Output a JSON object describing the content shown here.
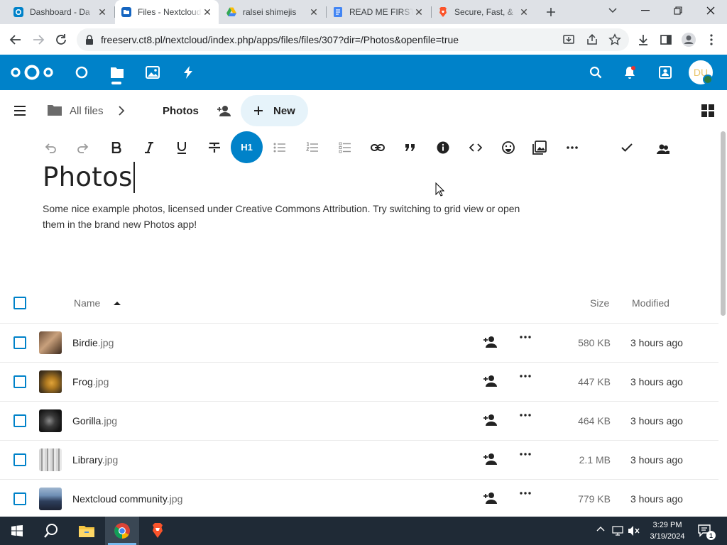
{
  "browser": {
    "tabs": [
      {
        "title": "Dashboard - Da",
        "favicon": "nextcloud-icon"
      },
      {
        "title": "Files - Nextcloud",
        "favicon": "files-icon",
        "active": true
      },
      {
        "title": "ralsei shimejis",
        "favicon": "drive-icon"
      },
      {
        "title": "READ ME FIRST",
        "favicon": "docs-icon"
      },
      {
        "title": "Secure, Fast, &",
        "favicon": "brave-icon"
      }
    ],
    "url": "freeserv.ct8.pl/nextcloud/index.php/apps/files/files/307?dir=/Photos&openfile=true"
  },
  "header": {
    "avatar_initials": "DU",
    "accent": "#0082c9"
  },
  "breadcrumb": {
    "root": "All files",
    "current": "Photos",
    "new_label": "New"
  },
  "editor": {
    "heading_button": "H1",
    "title": "Photos",
    "description": "Some nice example photos, licensed under Creative Commons Attribution. Try switching to grid view or open them in the brand new Photos app!"
  },
  "table": {
    "col_name": "Name",
    "col_size": "Size",
    "col_modified": "Modified",
    "rows": [
      {
        "base": "Birdie",
        "ext": ".jpg",
        "size": "580 KB",
        "modified": "3 hours ago"
      },
      {
        "base": "Frog",
        "ext": ".jpg",
        "size": "447 KB",
        "modified": "3 hours ago"
      },
      {
        "base": "Gorilla",
        "ext": ".jpg",
        "size": "464 KB",
        "modified": "3 hours ago"
      },
      {
        "base": "Library",
        "ext": ".jpg",
        "size": "2.1 MB",
        "modified": "3 hours ago"
      },
      {
        "base": "Nextcloud community",
        "ext": ".jpg",
        "size": "779 KB",
        "modified": "3 hours ago"
      }
    ]
  },
  "taskbar": {
    "time": "3:29 PM",
    "date": "3/19/2024",
    "notification_count": "1"
  }
}
